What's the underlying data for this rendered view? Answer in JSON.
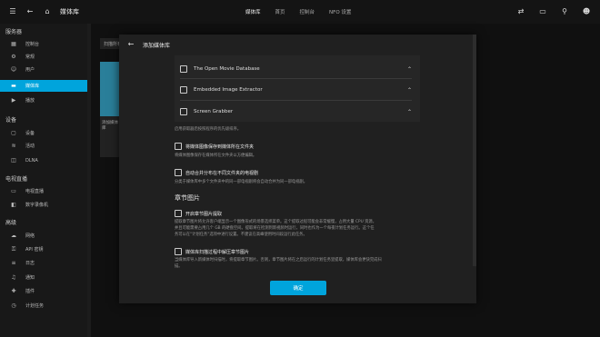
{
  "topbar": {
    "title": "媒体库",
    "tabs": [
      "媒体库",
      "首页",
      "控制台",
      "NFO 设置"
    ],
    "active_tab": 0
  },
  "sidebar": {
    "sections": [
      {
        "header": "服务器",
        "items": [
          "控制台",
          "常规",
          "用户",
          "媒体库",
          "播放"
        ]
      },
      {
        "header": "设备",
        "items": [
          "设备",
          "活动",
          "DLNA"
        ]
      },
      {
        "header": "电视直播",
        "items": [
          "电视直播",
          "数字录像机"
        ]
      },
      {
        "header": "高级",
        "items": [
          "网络",
          "API 密钥",
          "日志",
          "通知",
          "插件",
          "计划任务"
        ]
      }
    ],
    "active_item": "媒体库"
  },
  "background": {
    "button_label": "扫描所有",
    "card_label": "添加媒体库"
  },
  "modal": {
    "title": "添加媒体库",
    "providers": [
      "The Open Movie Database",
      "Embedded Image Extractor",
      "Screen Grabber"
    ],
    "providers_hint": "启用获取器后按照程序的优先级排序。",
    "options": [
      {
        "label": "将媒体图像保存到媒体所在文件夹",
        "hint": "将媒体图像保存在媒体所在文件夹以方便编辑。",
        "checked": false
      },
      {
        "label": "自动合并分布在不同文件夹的电视剧",
        "hint": "分类于媒体库中多个文件夹中的同一部电视剧将会自动合并为同一部电视剧。",
        "checked": false
      }
    ],
    "chapter_section": "章节图片",
    "chapter_options": [
      {
        "label": "开启章节图片提取",
        "hint_lines": [
          "提取章节图片将允许客户端显示一个图像形式的场景选择菜单。这个提取过程可能会非常缓慢，占用大量 CPU 资源，",
          "并且可能需要占用几个 GB 的硬盘空间。提取将在检测到新视频时运行，同时也作为一个每夜计划任务运行。这个任",
          "务可以在\"计划任务\"选项中进行设置。不建议在高峰使用时间段运行此任务。"
        ],
        "checked": false
      },
      {
        "label": "媒体库扫描过程中解压章节图片",
        "hint_lines": [
          "当媒体库导入新媒体时扫描时，将提取章节图片。否则，章节图片将在之后运行的计划任务里提取，媒体库会更快完成扫",
          "描。"
        ],
        "checked": false
      }
    ],
    "ok_label": "确定"
  },
  "colors": {
    "accent": "#00a4dc",
    "background": "#101010",
    "modal": "#202020"
  }
}
